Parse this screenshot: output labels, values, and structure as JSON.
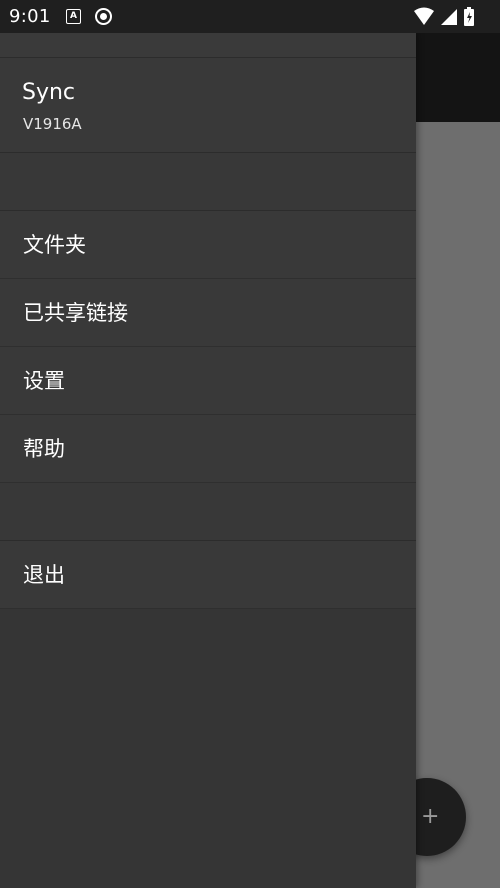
{
  "status_bar": {
    "time": "9:01",
    "icons": [
      "a-notification-icon",
      "circle-notification-icon",
      "wifi-icon",
      "signal-icon",
      "battery-icon"
    ]
  },
  "drawer": {
    "account": {
      "name": "Sync",
      "device": "V1916A"
    },
    "menu_items": [
      {
        "label": "文件夹"
      },
      {
        "label": "已共享链接"
      },
      {
        "label": "设置"
      },
      {
        "label": "帮助"
      }
    ],
    "logout": {
      "label": "退出"
    }
  },
  "fab": {
    "icon": "plus-icon",
    "symbol": "+"
  },
  "colors": {
    "drawer_bg": "#363636",
    "scrim_bg": "#6a6a6a",
    "status_bar": "#1f1f1f"
  }
}
